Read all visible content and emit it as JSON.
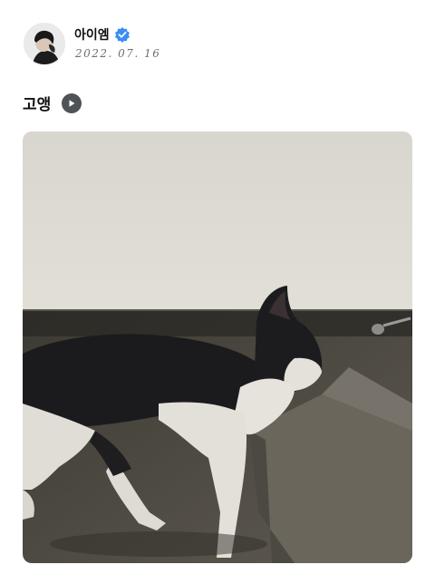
{
  "post": {
    "author": {
      "name": "아이엠",
      "verified": true,
      "verified_icon": "verified-badge-icon",
      "avatar_icon": "profile-avatar"
    },
    "date": "2022. 07. 16",
    "caption": "고앵",
    "play_icon": "play-icon",
    "photo": {
      "subject": "black-and-white-cat",
      "colors": {
        "wall": "#dedbd3",
        "floor": "#5d5950",
        "cat_black": "#1b1b1d",
        "cat_white": "#e6e3dc"
      }
    }
  },
  "colors": {
    "verified_badge": "#3b8ef3",
    "play_button": "#4f5358",
    "text_primary": "#111111",
    "text_secondary": "#6f6f6f"
  }
}
